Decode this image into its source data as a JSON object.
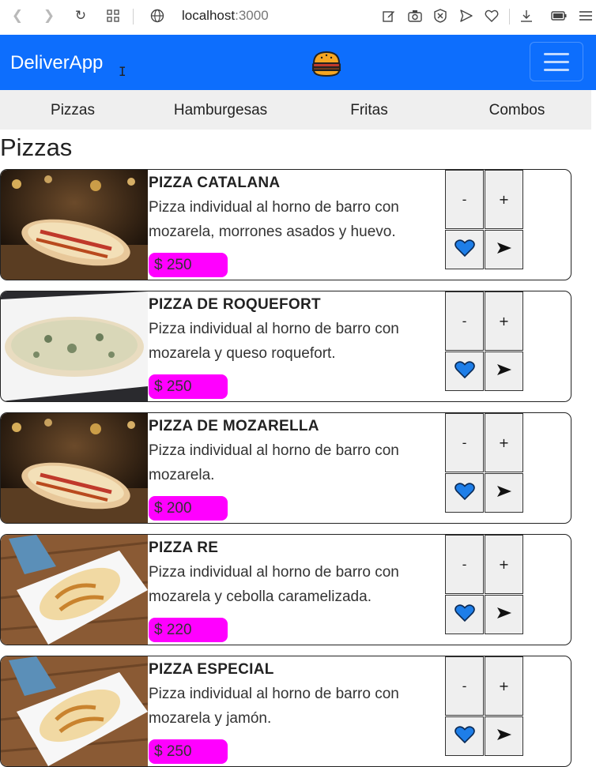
{
  "browser": {
    "url_host": "localhost",
    "url_port": ":3000"
  },
  "navbar": {
    "brand": "DeliverApp",
    "logo_icon": "burger-icon"
  },
  "categories": [
    "Pizzas",
    "Hamburgesas",
    "Fritas",
    "Combos"
  ],
  "section_title": "Pizzas",
  "colors": {
    "navbar": "#0d6efd",
    "price_badge": "#ff00ff",
    "heart": "#1e7ee8"
  },
  "buttons": {
    "minus": "-",
    "plus": "+"
  },
  "products": [
    {
      "name": "PIZZA CATALANA",
      "desc": "Pizza individual al horno de barro con mozarela, morrones asados y huevo.",
      "price": "$ 250",
      "photo": "dark"
    },
    {
      "name": "PIZZA DE ROQUEFORT",
      "desc": "Pizza individual al horno de barro con mozarela y queso roquefort.",
      "price": "$ 250",
      "photo": "plate"
    },
    {
      "name": "PIZZA DE MOZARELLA",
      "desc": "Pizza individual al horno de barro con mozarela.",
      "price": "$ 200",
      "photo": "dark"
    },
    {
      "name": "PIZZA RE",
      "desc": "Pizza individual al horno de barro con mozarela y cebolla caramelizada.",
      "price": "$ 220",
      "photo": "wood"
    },
    {
      "name": "PIZZA ESPECIAL",
      "desc": "Pizza individual al horno de barro con mozarela y jamón.",
      "price": "$ 250",
      "photo": "wood"
    }
  ]
}
